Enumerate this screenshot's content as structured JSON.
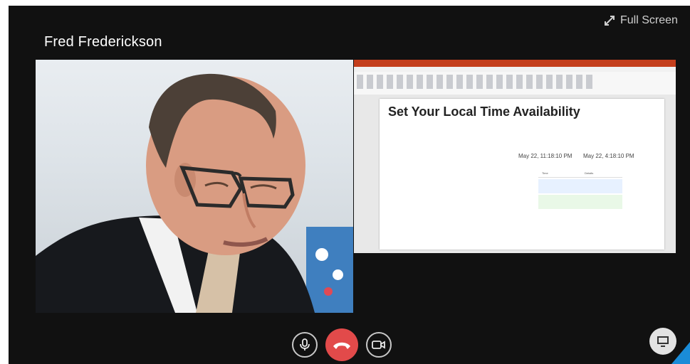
{
  "participant": {
    "name": "Fred Frederickson"
  },
  "header": {
    "fullscreen_label": "Full Screen",
    "fullscreen_icon": "expand-arrows-icon"
  },
  "shared_screen": {
    "slide_title": "Set Your Local Time Availability",
    "date_left": "May 22, 11:18:10 PM",
    "date_right": "May 22, 4:18:10 PM",
    "table": {
      "headers": [
        "Time",
        "Details"
      ]
    }
  },
  "controls": {
    "microphone_icon": "microphone-icon",
    "hangup_icon": "hang-up-icon",
    "camera_icon": "video-camera-icon",
    "screen_share_icon": "monitor-icon"
  },
  "colors": {
    "background": "#111111",
    "hangup": "#e24a4a",
    "accent": "#1a8cd8"
  }
}
